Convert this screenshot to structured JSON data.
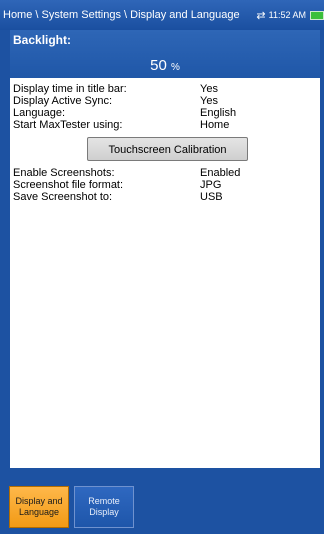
{
  "header": {
    "breadcrumb": "Home \\ System Settings \\ Display and Language",
    "time": "11:52 AM"
  },
  "backlight": {
    "label": "Backlight:",
    "value": "50",
    "unit": "%"
  },
  "settings": [
    {
      "label": "Display time in title bar:",
      "value": "Yes"
    },
    {
      "label": "Display Active Sync:",
      "value": "Yes"
    },
    {
      "label": "Language:",
      "value": "English"
    },
    {
      "label": "Start MaxTester using:",
      "value": "Home"
    }
  ],
  "calibration_button": "Touchscreen Calibration",
  "screenshot_settings": [
    {
      "label": "Enable Screenshots:",
      "value": "Enabled"
    },
    {
      "label": "Screenshot file format:",
      "value": "JPG"
    },
    {
      "label": "Save Screenshot to:",
      "value": "USB"
    }
  ],
  "tabs": [
    {
      "label": "Display and Language",
      "active": true
    },
    {
      "label": "Remote Display",
      "active": false
    }
  ],
  "colors": {
    "frame": "#1d52a2",
    "active_tab": "#f29a15",
    "inactive_tab": "#1e56aa"
  }
}
